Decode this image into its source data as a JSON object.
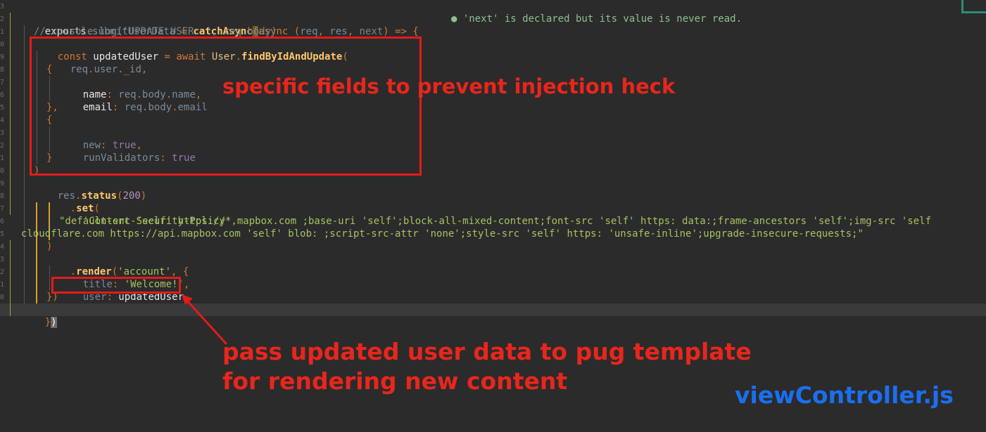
{
  "editor": {
    "lines": {
      "l1": {
        "a": "exports",
        "b": ".",
        "c": "submitUserData",
        "d": " = ",
        "e": "catchAsync",
        "f": "(",
        "g": "async",
        "h": " (",
        "i": "req",
        "j": ", ",
        "k": "res",
        "l": ", ",
        "m": "next",
        "n": ") => {"
      },
      "diagnostic": "● 'next' is declared but its value is never read.",
      "l2": "// console.log('UPDATE USER: ', req.body)",
      "l3": {
        "a": "const ",
        "b": "updatedUser",
        "c": " = ",
        "d": "await ",
        "e": "User",
        "f": ".",
        "g": "findByIdAndUpdate",
        "h": "("
      },
      "l4": {
        "a": "req",
        "b": ".",
        "c": "user",
        "d": ".",
        "e": "_id",
        "f": ","
      },
      "l5": "{",
      "l6": {
        "a": "name",
        "b": ": ",
        "c": "req",
        "d": ".",
        "e": "body",
        "f": ".",
        "g": "name",
        "h": ","
      },
      "l7": {
        "a": "email",
        "b": ": ",
        "c": "req",
        "d": ".",
        "e": "body",
        "f": ".",
        "g": "email"
      },
      "l8": "},",
      "l9": "{",
      "l10": {
        "a": "new",
        "b": ": ",
        "c": "true",
        "d": ","
      },
      "l11": {
        "a": "runValidators",
        "b": ": ",
        "c": "true"
      },
      "l12": "}",
      "l13": ")",
      "l14": {
        "a": "res",
        "b": ".",
        "c": "status",
        "d": "(",
        "e": "200",
        "f": ")"
      },
      "l15": {
        "a": ".",
        "b": "set",
        "c": "("
      },
      "l16": {
        "a": "'Content-Security-Policy'",
        "b": ","
      },
      "l17": "\"default-src 'self' https://*.mapbox.com ;base-uri 'self';block-all-mixed-content;font-src 'self' https: data:;frame-ancestors 'self';img-src 'self",
      "l18": "cloudflare.com https://api.mapbox.com 'self' blob: ;script-src-attr 'none';style-src 'self' https: 'unsafe-inline';upgrade-insecure-requests;\"",
      "l19": ")",
      "l20": {
        "a": ".",
        "b": "render",
        "c": "(",
        "d": "'account'",
        "e": ", {"
      },
      "l21": {
        "a": "title",
        "b": ": ",
        "c": "'Welcome!'",
        "d": ","
      },
      "l22": {
        "a": "user",
        "b": ": ",
        "c": "updatedUser"
      },
      "l23": "})",
      "l24": {
        "a": "}",
        "b": ")"
      }
    },
    "line_numbers": [
      "3",
      "2",
      "1",
      "0",
      "9",
      "8",
      "7",
      "6",
      "5",
      "4",
      "3",
      "2",
      "1",
      "0",
      "9",
      "8",
      "7",
      "6",
      "5",
      "4",
      "3",
      "2",
      "1",
      "0"
    ]
  },
  "annotations": {
    "box1_text": "specific fields to prevent injection heck",
    "box2_text_line1": "pass updated user data to pug template",
    "box2_text_line2": "for rendering new content",
    "file_name": "viewController.js"
  },
  "colors": {
    "annotation_red": "#e8261c",
    "file_label_blue": "#1a6ff0",
    "background": "#2b2b2b"
  }
}
